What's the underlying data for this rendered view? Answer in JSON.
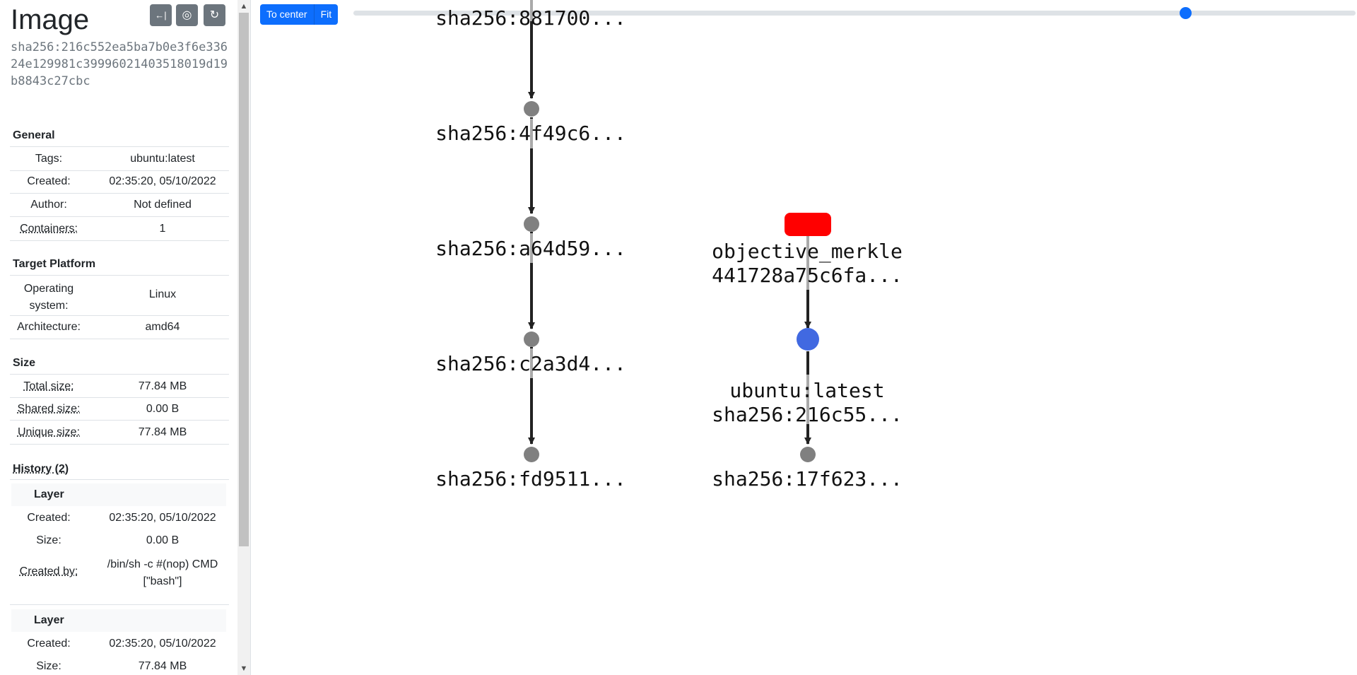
{
  "sidebar": {
    "title": "Image",
    "digest": "sha256:216c552ea5ba7b0e3f6e33624e129981c39996021403518019d19b8843c27cbc",
    "tools": {
      "collapse_icon": "←|",
      "target_icon": "◎",
      "refresh_icon": "↻"
    },
    "general": {
      "heading": "General",
      "rows": [
        {
          "k": "Tags:",
          "v": "ubuntu:latest"
        },
        {
          "k": "Created:",
          "v": "02:35:20, 05/10/2022"
        },
        {
          "k": "Author:",
          "v": "Not defined"
        },
        {
          "k": "Containers:",
          "v": "1"
        }
      ]
    },
    "platform": {
      "heading": "Target Platform",
      "rows": [
        {
          "k": "Operating system:",
          "v": "Linux"
        },
        {
          "k": "Architecture:",
          "v": "amd64"
        }
      ]
    },
    "size": {
      "heading": "Size",
      "rows": [
        {
          "k": "Total size:",
          "v": "77.84 MB"
        },
        {
          "k": "Shared size:",
          "v": "0.00 B"
        },
        {
          "k": "Unique size:",
          "v": "77.84 MB"
        }
      ]
    },
    "history": {
      "heading": "History (2)",
      "layers": [
        {
          "title": "Layer",
          "created_k": "Created:",
          "created": "02:35:20, 05/10/2022",
          "size_k": "Size:",
          "size": "0.00 B",
          "by_k": "Created by:",
          "by_line1": "/bin/sh -c #(nop) CMD",
          "by_line2": "[\"bash\"]"
        },
        {
          "title": "Layer",
          "created_k": "Created:",
          "created": "02:35:20, 05/10/2022",
          "size_k": "Size:",
          "size": "77.84 MB"
        }
      ]
    }
  },
  "toolbar": {
    "to_center": "To center",
    "fit": "Fit",
    "zoom_level": 0.83
  },
  "graph": {
    "nodes": {
      "n_top": "sha256:881700...",
      "n1": "sha256:4f49c6...",
      "n2": "sha256:a64d59...",
      "n3": "sha256:c2a3d4...",
      "n4": "sha256:fd9511...",
      "container_name": "objective_merkle",
      "container_id": "441728a75c6fa...",
      "image_tag": "ubuntu:latest",
      "image_id": "sha256:216c55...",
      "base": "sha256:17f623..."
    },
    "colors": {
      "node": "#808080",
      "container": "#ff0000",
      "image": "#4169e1",
      "edge": "#222222"
    }
  }
}
